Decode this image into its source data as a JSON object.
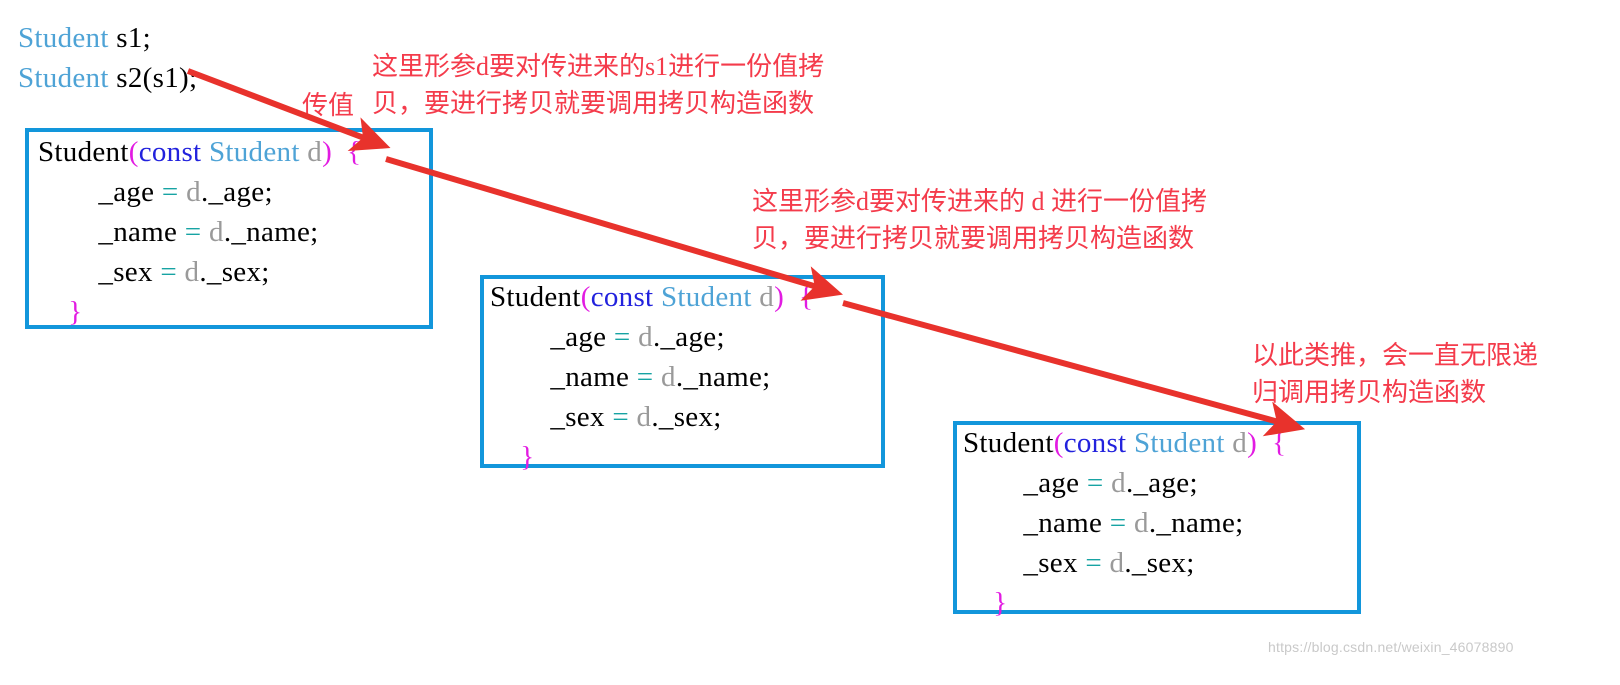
{
  "declaration": {
    "line1": {
      "type": "Student",
      "rest": " s1;"
    },
    "line2": {
      "type": "Student",
      "rest": " s2(s1);"
    }
  },
  "code_block": {
    "signature": {
      "name": "Student",
      "open_paren": "(",
      "keyword": "const",
      "type": "Student",
      "param": "d",
      "close_paren": ")",
      "open_brace": "{"
    },
    "body": [
      {
        "member": "_age",
        "op": "=",
        "obj": "d",
        "access": "._age;"
      },
      {
        "member": "_name",
        "op": "=",
        "obj": "d",
        "access": "._name;"
      },
      {
        "member": "_sex",
        "op": "=",
        "obj": "d",
        "access": "._sex;"
      }
    ],
    "close_brace": "}"
  },
  "annotations": {
    "pass_by_value_label": "传值",
    "note1_line1": "这里形参d要对传进来的s1进行一份值拷",
    "note1_line2": "贝，要进行拷贝就要调用拷贝构造函数",
    "note2_line1": "这里形参d要对传进来的 d 进行一份值拷",
    "note2_line2": "贝，要进行拷贝就要调用拷贝构造函数",
    "note3_line1": "以此类推，会一直无限递",
    "note3_line2": "归调用拷贝构造函数"
  },
  "watermark": "https://blog.csdn.net/weixin_46078890",
  "colors": {
    "box_border": "#1296db",
    "annotation_red": "#f43b4b",
    "arrow_red": "#e8322c",
    "keyword_blue": "#2222dd",
    "type_blue": "#4ea3d6",
    "punct_magenta": "#e21be2",
    "var_gray": "#9a9a9a",
    "operator_teal": "#17a3a3"
  }
}
